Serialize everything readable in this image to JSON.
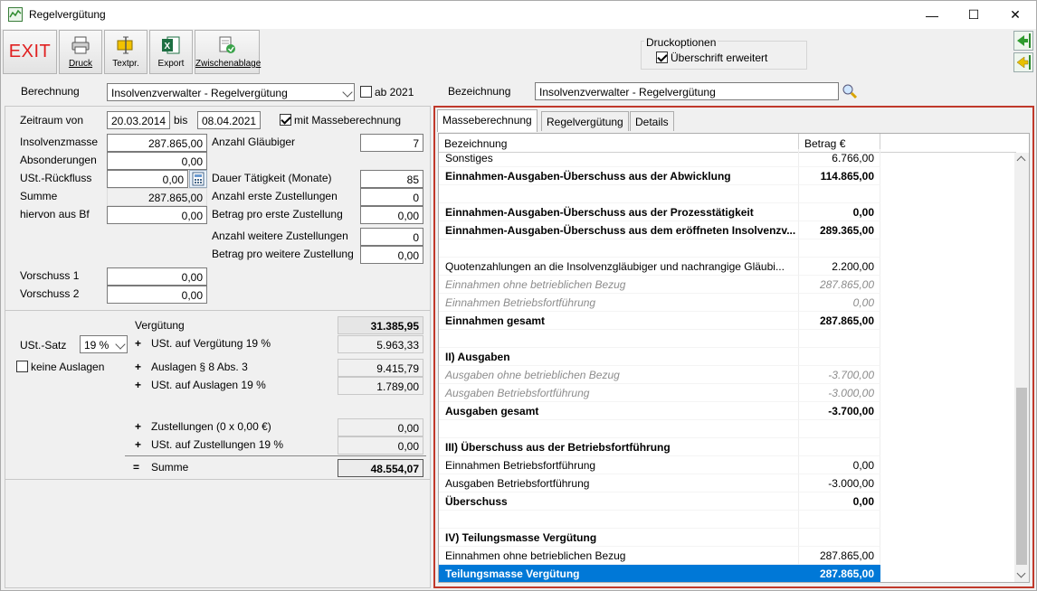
{
  "window": {
    "title": "Regelvergütung",
    "controls": {
      "minimize": "—",
      "maximize": "☐",
      "close": "✕"
    }
  },
  "toolbar": {
    "exit_label": "EXIT",
    "druck_label": "Druck",
    "textpr_label": "Textpr.",
    "export_label": "Export",
    "clipboard_label": "Zwischenablage",
    "druckoptionen_title": "Druckoptionen",
    "ueberschrift_label": "Überschrift erweitert",
    "ueberschrift_checked": true
  },
  "header": {
    "berechnung_label": "Berechnung",
    "berechnung_value": "Insolvenzverwalter - Regelvergütung",
    "ab2021_label": "ab 2021",
    "ab2021_checked": false,
    "bezeichnung_label": "Bezeichnung",
    "bezeichnung_value": "Insolvenzverwalter - Regelvergütung"
  },
  "left": {
    "zeitraum_label": "Zeitraum von",
    "zeitraum_von": "20.03.2014",
    "bis_label": "bis",
    "zeitraum_bis": "08.04.2021",
    "mit_masse_label": "mit Masseberechnung",
    "mit_masse_checked": true,
    "insolvenzmasse_label": "Insolvenzmasse",
    "insolvenzmasse_value": "287.865,00",
    "absonderungen_label": "Absonderungen",
    "absonderungen_value": "0,00",
    "ust_rueckfluss_label": "USt.-Rückfluss",
    "ust_rueckfluss_value": "0,00",
    "summe_label": "Summe",
    "summe_value": "287.865,00",
    "hiervon_label": "hiervon aus Bf",
    "hiervon_value": "0,00",
    "anzahl_glaeubiger_label": "Anzahl Gläubiger",
    "anzahl_glaeubiger_value": "7",
    "dauer_label": "Dauer Tätigkeit (Monate)",
    "dauer_value": "85",
    "anzahl_erste_label": "Anzahl erste Zustellungen",
    "anzahl_erste_value": "0",
    "betrag_erste_label": "Betrag pro erste Zustellung",
    "betrag_erste_value": "0,00",
    "anzahl_weitere_label": "Anzahl weitere Zustellungen",
    "anzahl_weitere_value": "0",
    "betrag_weitere_label": "Betrag pro weitere Zustellung",
    "betrag_weitere_value": "0,00",
    "vorschuss1_label": "Vorschuss 1",
    "vorschuss1_value": "0,00",
    "vorschuss2_label": "Vorschuss 2",
    "vorschuss2_value": "0,00",
    "ust_satz_label": "USt.-Satz",
    "ust_satz_value": "19 %",
    "keine_auslagen_label": "keine Auslagen",
    "keine_auslagen_checked": false
  },
  "summary": {
    "verguetung_label": "Vergütung",
    "verguetung_value": "31.385,95",
    "ust_verguetung_label": "USt. auf Vergütung 19 %",
    "ust_verguetung_value": "5.963,33",
    "auslagen_label": "Auslagen § 8 Abs. 3",
    "auslagen_value": "9.415,79",
    "ust_auslagen_label": "USt. auf Auslagen 19 %",
    "ust_auslagen_value": "1.789,00",
    "zustellungen_label": "Zustellungen (0 x 0,00 €)",
    "zustellungen_value": "0,00",
    "ust_zustellungen_label": "USt. auf Zustellungen 19 %",
    "ust_zustellungen_value": "0,00",
    "summe_label": "Summe",
    "summe_value": "48.554,07",
    "plus": "+",
    "equals": "="
  },
  "tabs": [
    {
      "label": "Masseberechnung",
      "active": true
    },
    {
      "label": "Regelvergütung",
      "active": false
    },
    {
      "label": "Details",
      "active": false
    }
  ],
  "grid": {
    "headers": [
      "Bezeichnung",
      "Betrag €"
    ],
    "rows": [
      {
        "label": "Sonstiges",
        "value": "6.766,00",
        "style": ""
      },
      {
        "label": "Einnahmen-Ausgaben-Überschuss aus der Abwicklung",
        "value": "114.865,00",
        "style": "b"
      },
      {
        "label": "",
        "value": "",
        "style": ""
      },
      {
        "label": "Einnahmen-Ausgaben-Überschuss aus der Prozesstätigkeit",
        "value": "0,00",
        "style": "b"
      },
      {
        "label": "Einnahmen-Ausgaben-Überschuss aus dem eröffneten Insolvenzv...",
        "value": "289.365,00",
        "style": "b"
      },
      {
        "label": "",
        "value": "",
        "style": ""
      },
      {
        "label": "Quotenzahlungen an die Insolvenzgläubiger und nachrangige Gläubi...",
        "value": "2.200,00",
        "style": ""
      },
      {
        "label": "Einnahmen ohne betrieblichen Bezug",
        "value": "287.865,00",
        "style": "i"
      },
      {
        "label": "Einnahmen Betriebsfortführung",
        "value": "0,00",
        "style": "i"
      },
      {
        "label": "Einnahmen gesamt",
        "value": "287.865,00",
        "style": "b"
      },
      {
        "label": "",
        "value": "",
        "style": ""
      },
      {
        "label": "II) Ausgaben",
        "value": "",
        "style": "b"
      },
      {
        "label": "Ausgaben ohne betrieblichen Bezug",
        "value": "-3.700,00",
        "style": "i"
      },
      {
        "label": "Ausgaben Betriebsfortführung",
        "value": "-3.000,00",
        "style": "i"
      },
      {
        "label": "Ausgaben gesamt",
        "value": "-3.700,00",
        "style": "b"
      },
      {
        "label": "",
        "value": "",
        "style": ""
      },
      {
        "label": "III) Überschuss aus der Betriebsfortführung",
        "value": "",
        "style": "b"
      },
      {
        "label": "Einnahmen Betriebsfortführung",
        "value": "0,00",
        "style": ""
      },
      {
        "label": "Ausgaben Betriebsfortführung",
        "value": "-3.000,00",
        "style": ""
      },
      {
        "label": "Überschuss",
        "value": "0,00",
        "style": "b"
      },
      {
        "label": "",
        "value": "",
        "style": ""
      },
      {
        "label": "IV) Teilungsmasse Vergütung",
        "value": "",
        "style": "b"
      },
      {
        "label": "Einnahmen ohne betrieblichen Bezug",
        "value": "287.865,00",
        "style": ""
      },
      {
        "label": "Teilungsmasse Vergütung",
        "value": "287.865,00",
        "style": "b sel"
      }
    ]
  },
  "colors": {
    "selection": "#0078d7",
    "exit_red": "#e02020",
    "frame_red": "#c0392b"
  },
  "icons": {
    "app": "app-chart-icon",
    "druck": "printer-icon",
    "textpr": "text-print-icon",
    "export": "excel-icon",
    "clipboard": "clipboard-icon",
    "nav_back_1": "arrow-left-green-icon",
    "nav_back_2": "arrow-left-yellow-icon",
    "lookup": "magnifier-icon",
    "calculator": "calculator-icon"
  }
}
